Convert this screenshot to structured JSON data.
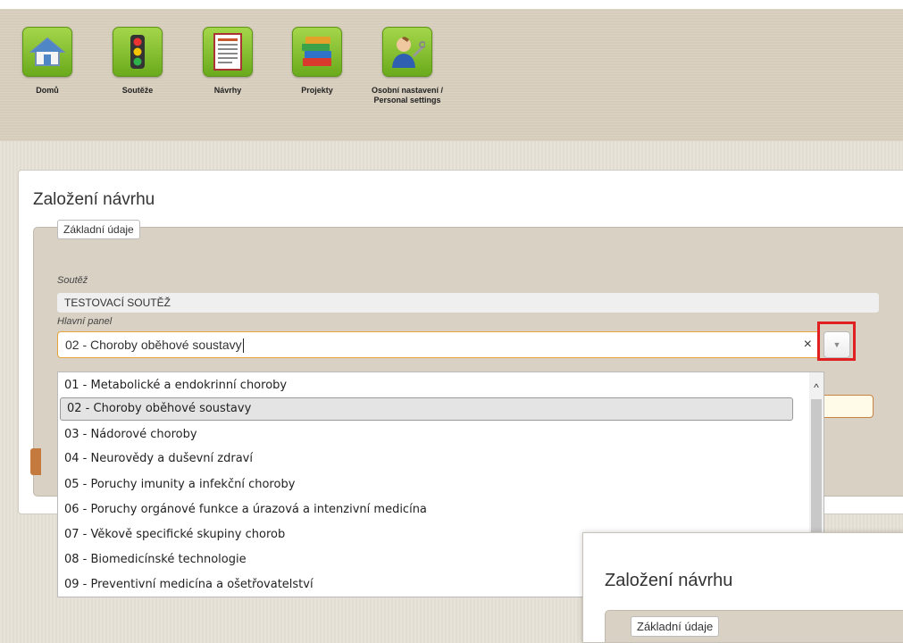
{
  "toolbar": {
    "items": [
      {
        "label": "Domů",
        "icon": "home-icon"
      },
      {
        "label": "Soutěže",
        "icon": "traffic-light-icon"
      },
      {
        "label": "Návrhy",
        "icon": "document-icon"
      },
      {
        "label": "Projekty",
        "icon": "books-icon"
      },
      {
        "label": "Osobní nastavení / Personal settings",
        "icon": "user-settings-icon"
      }
    ]
  },
  "form": {
    "title": "Založení návrhu",
    "legend": "Základní údaje",
    "competition_label": "Soutěž",
    "competition_value": "TESTOVACÍ SOUTĚŽ",
    "panel_label": "Hlavní panel",
    "panel_value": "02 - Choroby oběhové soustavy",
    "clear_symbol": "×",
    "dropdown_symbol": "▼"
  },
  "dropdown": {
    "selected_index": 1,
    "options": [
      "01 - Metabolické a endokrinní choroby",
      "02 - Choroby oběhové soustavy",
      "03 - Nádorové choroby",
      "04 - Neurovědy a duševní zdraví",
      "05 - Poruchy imunity a infekční choroby",
      "06 - Poruchy orgánové funkce a úrazová a intenzivní medicína",
      "07 - Věkově specifické skupiny chorob",
      "08 - Biomedicínské technologie",
      "09 - Preventivní medicína a ošetřovatelství"
    ]
  },
  "inset": {
    "title": "Založení návrhu",
    "legend": "Základní údaje"
  },
  "colors": {
    "highlight": "#e02020",
    "tile_green": "#7cb82a",
    "input_focus": "#e8a33a"
  }
}
